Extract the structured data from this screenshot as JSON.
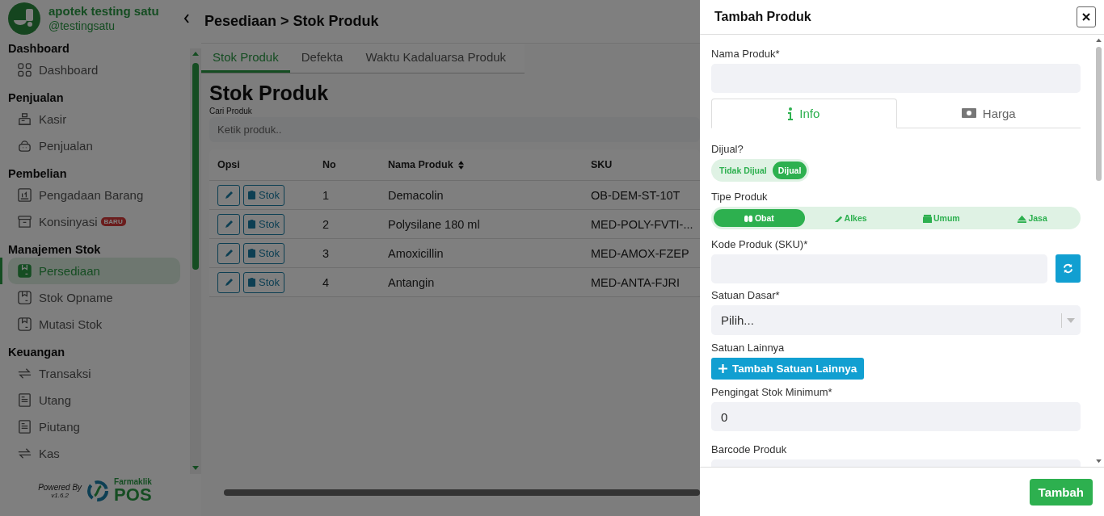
{
  "sidebar": {
    "brand": {
      "name": "apotek testing satu",
      "handle": "@testingsatu"
    },
    "sections": [
      {
        "title": "Dashboard",
        "items": [
          {
            "label": "Dashboard",
            "selected": false
          }
        ]
      },
      {
        "title": "Penjualan",
        "items": [
          {
            "label": "Kasir",
            "selected": false
          },
          {
            "label": "Penjualan",
            "selected": false
          }
        ]
      },
      {
        "title": "Pembelian",
        "items": [
          {
            "label": "Pengadaan Barang",
            "selected": false
          },
          {
            "label": "Konsinyasi",
            "badge": "BARU",
            "selected": false
          }
        ]
      },
      {
        "title": "Manajemen Stok",
        "items": [
          {
            "label": "Persediaan",
            "selected": true
          },
          {
            "label": "Stok Opname",
            "selected": false
          },
          {
            "label": "Mutasi Stok",
            "selected": false
          }
        ]
      },
      {
        "title": "Keuangan",
        "items": [
          {
            "label": "Transaksi",
            "selected": false
          },
          {
            "label": "Utang",
            "selected": false
          },
          {
            "label": "Piutang",
            "selected": false
          },
          {
            "label": "Kas",
            "selected": false
          }
        ]
      }
    ],
    "footer": {
      "powered_by": "Powered By",
      "version": "v1.6.2",
      "logo_brand": "Farmaklik",
      "logo_product": "POS"
    }
  },
  "main": {
    "breadcrumb": "Pesediaan > Stok Produk",
    "tabs": [
      {
        "label": "Stok Produk",
        "selected": true
      },
      {
        "label": "Defekta",
        "selected": false
      },
      {
        "label": "Waktu Kadaluarsa Produk",
        "selected": false
      }
    ],
    "title": "Stok Produk",
    "search": {
      "label": "Cari Produk",
      "placeholder": "Ketik produk.."
    },
    "table": {
      "columns": [
        {
          "label": "Opsi",
          "sortable": false
        },
        {
          "label": "No",
          "sortable": false
        },
        {
          "label": "Nama Produk",
          "sortable": true
        },
        {
          "label": "SKU",
          "sortable": false
        }
      ],
      "rows": [
        {
          "stock_button": "Stok",
          "no": "1",
          "name": "Demacolin",
          "sku": "OB-DEM-ST-10T"
        },
        {
          "stock_button": "Stok",
          "no": "2",
          "name": "Polysilane 180 ml",
          "sku": "MED-POLY-FVTI-..."
        },
        {
          "stock_button": "Stok",
          "no": "3",
          "name": "Amoxicillin",
          "sku": "MED-AMOX-FZEP"
        },
        {
          "stock_button": "Stok",
          "no": "4",
          "name": "Antangin",
          "sku": "MED-ANTA-FJRI"
        }
      ]
    }
  },
  "drawer": {
    "title": "Tambah Produk",
    "name_field": {
      "label": "Nama Produk*"
    },
    "tabs": [
      {
        "label": "Info",
        "selected": true
      },
      {
        "label": "Harga",
        "selected": false
      }
    ],
    "sold": {
      "label": "Dijual?",
      "options": [
        {
          "label": "Tidak Dijual",
          "selected": false
        },
        {
          "label": "Dijual",
          "selected": true
        }
      ]
    },
    "product_type": {
      "label": "Tipe Produk",
      "options": [
        {
          "label": "Obat",
          "selected": true
        },
        {
          "label": "Alkes",
          "selected": false
        },
        {
          "label": "Umum",
          "selected": false
        },
        {
          "label": "Jasa",
          "selected": false
        }
      ]
    },
    "sku_field": {
      "label": "Kode Produk (SKU)*"
    },
    "base_unit": {
      "label": "Satuan Dasar*",
      "placeholder": "Pilih..."
    },
    "other_units": {
      "label": "Satuan Lainnya",
      "button": "Tambah Satuan Lainnya"
    },
    "min_stock": {
      "label": "Pengingat Stok Minimum*",
      "value": "0"
    },
    "barcode": {
      "label": "Barcode Produk"
    },
    "submit": "Tambah"
  }
}
